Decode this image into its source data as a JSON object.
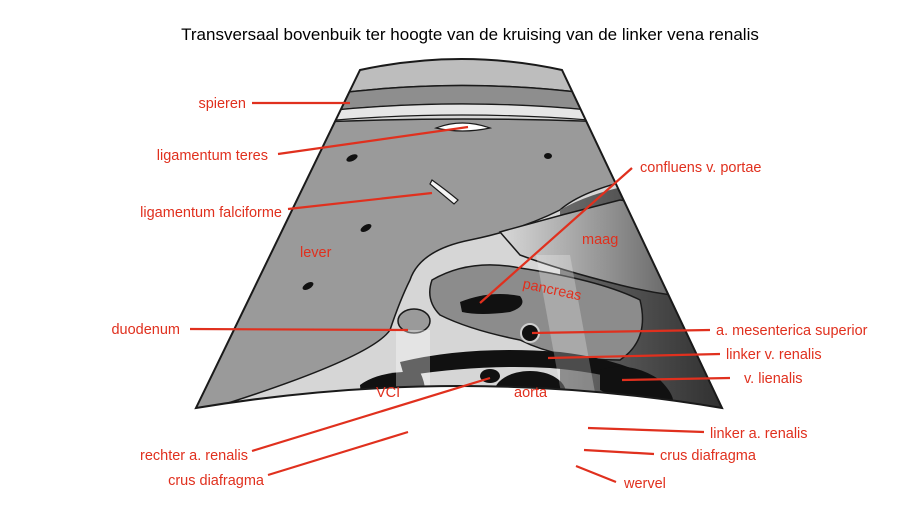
{
  "title": "Transversaal bovenbuik ter hoogte van de kruising van de linker vena renalis",
  "colors": {
    "label": "#e0301e",
    "line": "#e0301e",
    "outline": "#1a1a1a",
    "liver": "#9a9a9a",
    "dark": "#111111"
  },
  "labels": {
    "spieren": "spieren",
    "ligamentum_teres": "ligamentum teres",
    "ligamentum_falciforme": "ligamentum falciforme",
    "lever": "lever",
    "duodenum": "duodenum",
    "rechter_a_renalis": "rechter a. renalis",
    "crus_diafragma_left": "crus diafragma",
    "confluens_v_portae": "confluens v. portae",
    "maag": "maag",
    "pancreas": "pancreas",
    "a_mesenterica_superior": "a. mesenterica superior",
    "linker_v_renalis": "linker v. renalis",
    "v_lienalis": "v. lienalis",
    "vci": "VCI",
    "aorta": "aorta",
    "linker_a_renalis": "linker a. renalis",
    "crus_diafragma_right": "crus diafragma",
    "wervel": "wervel"
  }
}
